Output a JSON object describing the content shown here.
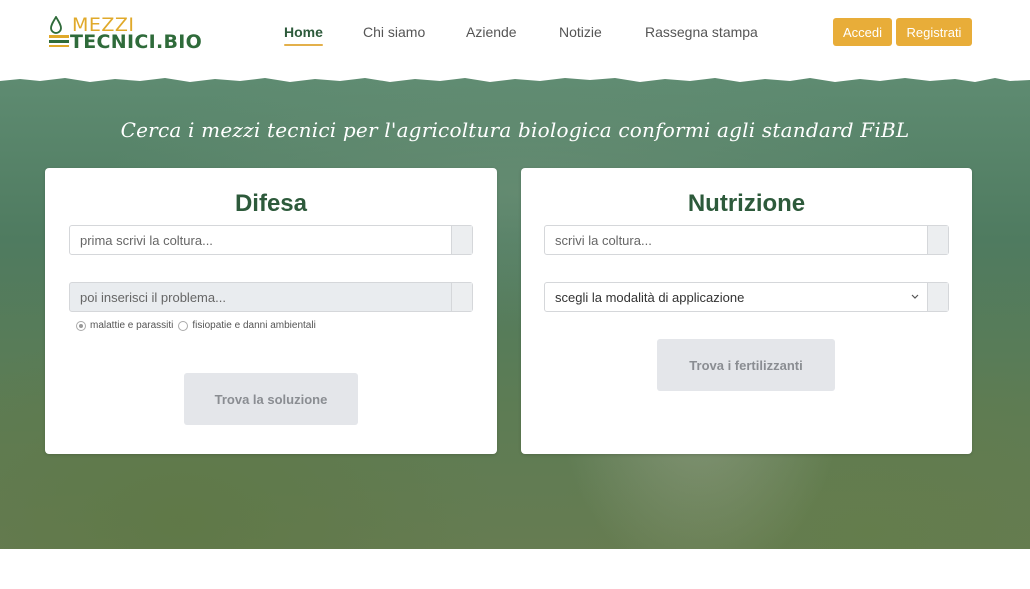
{
  "logo": {
    "line1": "MEZZI",
    "line2": "TECNICI.BIO"
  },
  "nav": {
    "items": [
      {
        "label": "Home",
        "active": true
      },
      {
        "label": "Chi siamo"
      },
      {
        "label": "Aziende"
      },
      {
        "label": "Notizie"
      },
      {
        "label": "Rassegna stampa"
      }
    ],
    "login_label": "Accedi",
    "register_label": "Registrati"
  },
  "hero": {
    "title": "Cerca i mezzi tecnici per l'agricoltura biologica conformi agli standard FiBL"
  },
  "difesa": {
    "title": "Difesa",
    "crop_placeholder": "prima scrivi la coltura...",
    "problem_placeholder": "poi inserisci il problema...",
    "radio_1": "malattie e parassiti",
    "radio_2": "fisiopatie e danni ambientali",
    "button": "Trova la soluzione"
  },
  "nutrizione": {
    "title": "Nutrizione",
    "crop_placeholder": "scrivi la coltura...",
    "mode_selected": "scegli la modalità di applicazione",
    "button": "Trova i fertilizzanti"
  },
  "colors": {
    "brand_green": "#2d5a3b",
    "accent_yellow": "#e8ad39"
  }
}
